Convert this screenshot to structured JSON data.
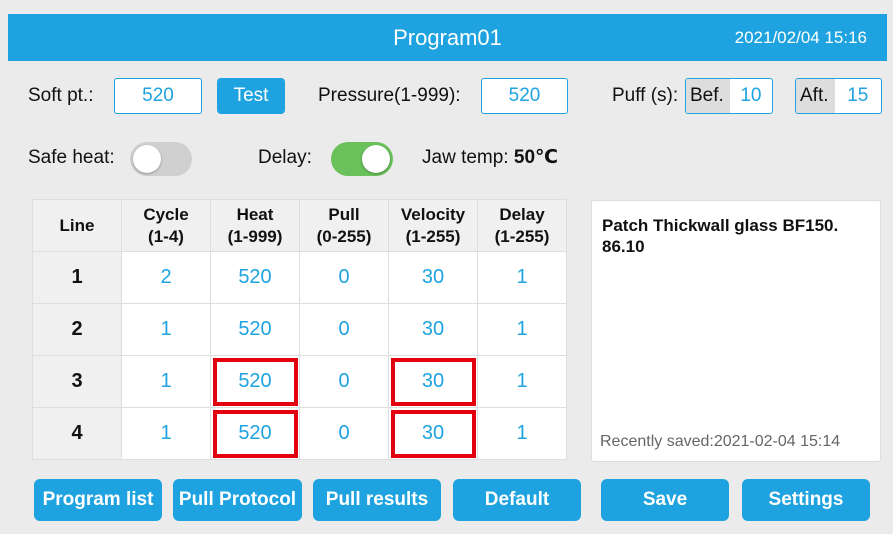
{
  "header": {
    "title": "Program01",
    "datetime": "2021/02/04  15:16"
  },
  "controls": {
    "soft_pt_label": "Soft pt.:",
    "soft_pt_value": "520",
    "test_label": "Test",
    "pressure_label": "Pressure(1-999):",
    "pressure_value": "520",
    "puff_label": "Puff (s):",
    "bef_label": "Bef.",
    "bef_value": "10",
    "aft_label": "Aft.",
    "aft_value": "15",
    "safe_heat_label": "Safe heat:",
    "safe_heat_on": false,
    "delay_label": "Delay:",
    "delay_on": true,
    "jaw_temp_label": "Jaw temp:",
    "jaw_temp_value": "50℃"
  },
  "table": {
    "headers": [
      {
        "name": "Line",
        "range": ""
      },
      {
        "name": "Cycle",
        "range": "(1-4)"
      },
      {
        "name": "Heat",
        "range": "(1-999)"
      },
      {
        "name": "Pull",
        "range": "(0-255)"
      },
      {
        "name": "Velocity",
        "range": "(1-255)"
      },
      {
        "name": "Delay",
        "range": "(1-255)"
      }
    ],
    "rows": [
      [
        "1",
        "2",
        "520",
        "0",
        "30",
        "1"
      ],
      [
        "2",
        "1",
        "520",
        "0",
        "30",
        "1"
      ],
      [
        "3",
        "1",
        "520",
        "0",
        "30",
        "1"
      ],
      [
        "4",
        "1",
        "520",
        "0",
        "30",
        "1"
      ]
    ]
  },
  "notes": {
    "text": "Patch Thickwall glass BF150.\n86.10",
    "saved": "Recently saved:2021-02-04 15:14"
  },
  "buttons": {
    "program_list": "Program list",
    "pull_protocol": "Pull Protocol",
    "pull_results": "Pull results",
    "default": "Default",
    "save": "Save",
    "settings": "Settings"
  },
  "colors": {
    "accent": "#1ea3e0",
    "toggle_on": "#6ac05a",
    "toggle_off": "#cfcfcf",
    "highlight": "#e3000f"
  }
}
